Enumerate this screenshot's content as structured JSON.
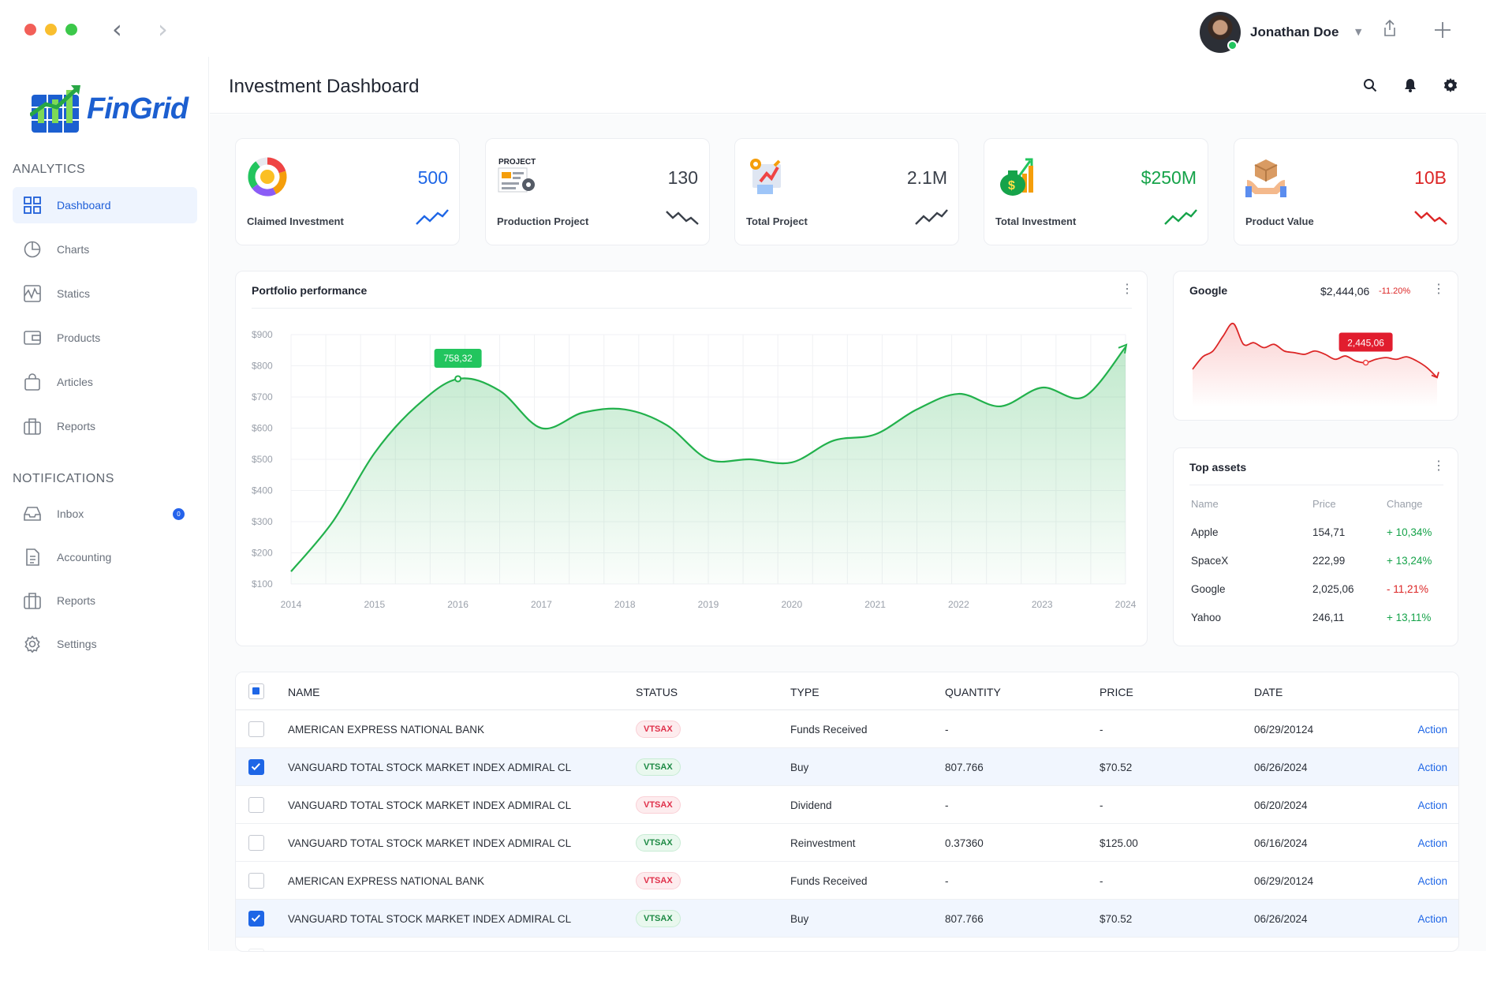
{
  "window": {
    "user_name": "Jonathan Doe"
  },
  "brand": {
    "logo_text": "FinGrid"
  },
  "sidebar": {
    "analytics_title": "ANALYTICS",
    "analytics_items": [
      {
        "label": "Dashboard",
        "icon": "grid-icon"
      },
      {
        "label": "Charts",
        "icon": "pie-icon"
      },
      {
        "label": "Statics",
        "icon": "activity-icon"
      },
      {
        "label": "Products",
        "icon": "wallet-icon"
      },
      {
        "label": "Articles",
        "icon": "bag-icon"
      },
      {
        "label": "Reports",
        "icon": "briefcase-icon"
      }
    ],
    "notifications_title": "NOTIFICATIONS",
    "notification_items": [
      {
        "label": "Inbox",
        "icon": "inbox-icon",
        "badge": "0"
      },
      {
        "label": "Accounting",
        "icon": "document-icon"
      },
      {
        "label": "Reports",
        "icon": "briefcase-icon"
      },
      {
        "label": "Settings",
        "icon": "gear-icon"
      }
    ]
  },
  "header": {
    "title": "Investment Dashboard"
  },
  "kpis": [
    {
      "label": "Claimed Investment",
      "value": "500",
      "color": "#1e66e6",
      "trend": "up",
      "trend_color": "#1e66e6"
    },
    {
      "label": "Production Project",
      "value": "130",
      "color": "#3a404a",
      "trend": "down",
      "trend_color": "#3a404a",
      "icon_caption": "PROJECT"
    },
    {
      "label": "Total Project",
      "value": "2.1M",
      "color": "#3a404a",
      "trend": "up",
      "trend_color": "#3a404a"
    },
    {
      "label": "Total Investment",
      "value": "$250M",
      "color": "#16a34a",
      "trend": "up",
      "trend_color": "#16a34a"
    },
    {
      "label": "Product Value",
      "value": "10B",
      "color": "#dc2626",
      "trend": "down",
      "trend_color": "#dc2626"
    }
  ],
  "portfolio": {
    "title": "Portfolio performance",
    "chart_data": {
      "type": "area",
      "x": [
        2014,
        2014.5,
        2015,
        2015.5,
        2016,
        2016.5,
        2017,
        2017.5,
        2018,
        2018.5,
        2019,
        2019.5,
        2020,
        2020.5,
        2021,
        2021.5,
        2022,
        2022.5,
        2023,
        2023.5,
        2024
      ],
      "y": [
        140,
        300,
        520,
        670,
        758,
        720,
        600,
        650,
        660,
        610,
        500,
        500,
        490,
        560,
        580,
        660,
        710,
        670,
        730,
        700,
        860
      ],
      "x_tick_labels": [
        "2014",
        "2015",
        "2016",
        "2017",
        "2018",
        "2019",
        "2020",
        "2021",
        "2022",
        "2023",
        "2024"
      ],
      "y_tick_labels": [
        "$900",
        "$800",
        "$700",
        "$600",
        "$500",
        "$400",
        "$300",
        "$200",
        "$100"
      ],
      "ylim": [
        100,
        900
      ],
      "grid": true,
      "annotation": {
        "x": 2016,
        "y": 758.32,
        "label": "758,32"
      },
      "line_color": "#22b14c"
    }
  },
  "google": {
    "title": "Google",
    "price": "$2,444,06",
    "change": "-11.20%",
    "tooltip": "2,445,06",
    "chart_data": {
      "type": "area",
      "y": [
        40,
        55,
        62,
        80,
        95,
        70,
        72,
        66,
        70,
        62,
        60,
        58,
        62,
        58,
        52,
        56,
        50,
        48,
        52,
        54,
        52,
        55,
        50,
        42,
        30
      ],
      "line_color": "#dc2626"
    }
  },
  "top_assets": {
    "title": "Top assets",
    "columns": [
      "Name",
      "Price",
      "Change"
    ],
    "rows": [
      {
        "name": "Apple",
        "price": "154,71",
        "change": "+ 10,34%",
        "positive": true
      },
      {
        "name": "SpaceX",
        "price": "222,99",
        "change": "+ 13,24%",
        "positive": true
      },
      {
        "name": "Google",
        "price": "2,025,06",
        "change": "- 11,21%",
        "positive": false
      },
      {
        "name": "Yahoo",
        "price": "246,11",
        "change": "+ 13,11%",
        "positive": true
      }
    ]
  },
  "table": {
    "columns": [
      "NAME",
      "STATUS",
      "TYPE",
      "QUANTITY",
      "PRICE",
      "DATE"
    ],
    "action_label": "Action",
    "rows": [
      {
        "name": "AMERICAN EXPRESS NATIONAL BANK",
        "status": "VTSAX",
        "status_color": "red",
        "type": "Funds Received",
        "quantity": "-",
        "price": "-",
        "date": "06/29/20124",
        "checked": false
      },
      {
        "name": "VANGUARD TOTAL STOCK MARKET INDEX ADMIRAL CL",
        "status": "VTSAX",
        "status_color": "green",
        "type": "Buy",
        "quantity": "807.766",
        "price": "$70.52",
        "date": "06/26/2024",
        "checked": true
      },
      {
        "name": "VANGUARD TOTAL STOCK MARKET INDEX ADMIRAL CL",
        "status": "VTSAX",
        "status_color": "red",
        "type": "Dividend",
        "quantity": "-",
        "price": "-",
        "date": "06/20/2024",
        "checked": false
      },
      {
        "name": "VANGUARD TOTAL STOCK MARKET INDEX ADMIRAL CL",
        "status": "VTSAX",
        "status_color": "green",
        "type": "Reinvestment",
        "quantity": "0.37360",
        "price": "$125.00",
        "date": "06/16/2024",
        "checked": false
      },
      {
        "name": "AMERICAN EXPRESS NATIONAL BANK",
        "status": "VTSAX",
        "status_color": "red",
        "type": "Funds Received",
        "quantity": "-",
        "price": "-",
        "date": "06/29/20124",
        "checked": false
      },
      {
        "name": "VANGUARD TOTAL STOCK MARKET INDEX ADMIRAL CL",
        "status": "VTSAX",
        "status_color": "green",
        "type": "Buy",
        "quantity": "807.766",
        "price": "$70.52",
        "date": "06/26/2024",
        "checked": true
      }
    ]
  }
}
